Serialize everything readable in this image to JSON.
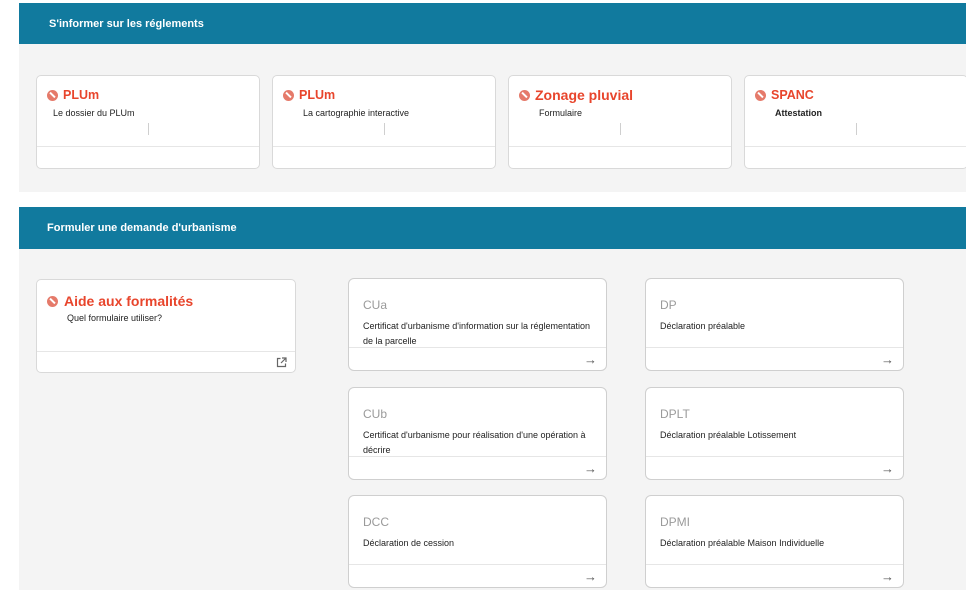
{
  "sections": [
    {
      "title": "S'informer sur les réglements",
      "cards": [
        {
          "title": "PLUm",
          "subtitle": "Le dossier du PLUm"
        },
        {
          "title": "PLUm",
          "subtitle": "La cartographie interactive"
        },
        {
          "title": "Zonage pluvial",
          "subtitle": "Formulaire"
        },
        {
          "title": "SPANC",
          "subtitle": "Attestation"
        }
      ]
    },
    {
      "title": "Formuler une demande d'urbanisme",
      "aide": {
        "title": "Aide aux formalités",
        "subtitle": "Quel formulaire utiliser?"
      },
      "forms": [
        {
          "code": "CUa",
          "desc": "Certificat d'urbanisme d'information sur la réglementation de la parcelle"
        },
        {
          "code": "DP",
          "desc": "Déclaration préalable"
        },
        {
          "code": "CUb",
          "desc": "Certificat d'urbanisme pour réalisation d'une opération à décrire"
        },
        {
          "code": "DPLT",
          "desc": "Déclaration préalable Lotissement"
        },
        {
          "code": "DCC",
          "desc": "Déclaration de cession"
        },
        {
          "code": "DPMI",
          "desc": "Déclaration préalable Maison Individuelle"
        }
      ]
    }
  ],
  "icons": {
    "arrow": "→",
    "external_link": "external-link-icon",
    "status": "no-entry-icon"
  },
  "colors": {
    "header": "#117a9e",
    "accent": "#e8452c",
    "panel": "#f4f4f4"
  }
}
